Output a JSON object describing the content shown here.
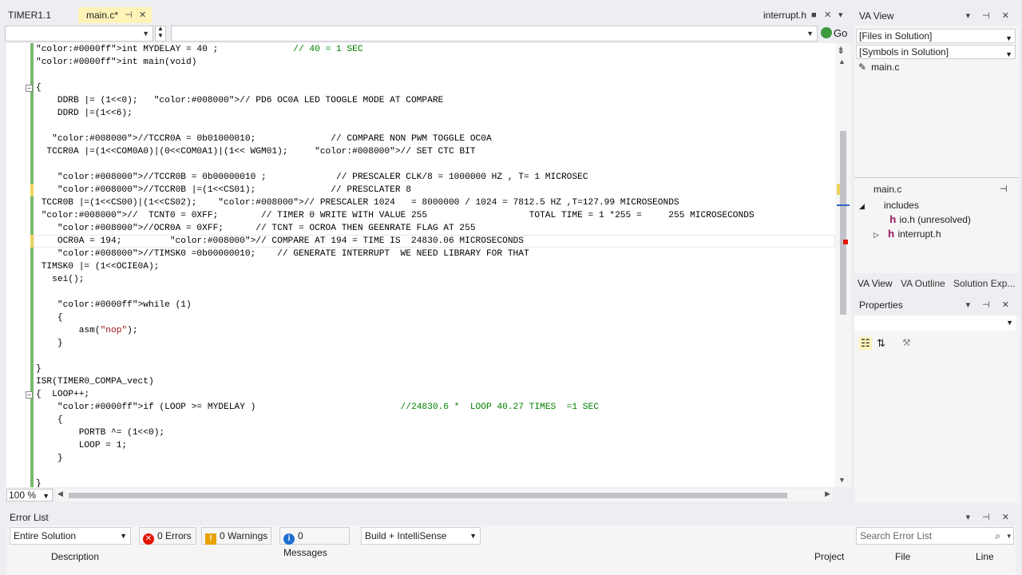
{
  "tabs": {
    "timer": "TIMER1.1",
    "main": "main.c*",
    "interrupt": "interrupt.h"
  },
  "navbar": {
    "go": "Go"
  },
  "zoom": "100 %",
  "code": [
    "int MYDELAY = 40 ;              // 40 = 1 SEC",
    "int main(void)",
    "",
    "{",
    "    DDRB |= (1<<0);   // PD6 OC0A LED TOOGLE MODE AT COMPARE",
    "    DDRD |=(1<<6);",
    "",
    "   //TCCR0A = 0b01000010;              // COMPARE NON PWM TOGGLE OC0A",
    "  TCCR0A |=(1<<COM0A0)|(0<<COM0A1)|(1<< WGM01);     // SET CTC BIT",
    "",
    "    //TCCR0B = 0b00000010 ;             // PRESCALER CLK/8 = 1000000 HZ , T= 1 MICROSEC",
    "    //TCCR0B |=(1<<CS01);              // PRESCLATER 8",
    " TCCR0B |=(1<<CS00)|(1<<CS02);    // PRESCALER 1024   = 8000000 / 1024 = 7812.5 HZ ,T=127.99 MICROSEONDS",
    " //  TCNT0 = 0XFF;        // TIMER 0 WRITE WITH VALUE 255                   TOTAL TIME = 1 *255 =     255 MICROSECONDS",
    "    //OCR0A = 0XFF;      // TCNT = OCROA THEN GEENRATE FLAG AT 255",
    "    OCR0A = 194;         // COMPARE AT 194 = TIME IS  24830.06 MICROSECONDS",
    "    //TIMSK0 =0b00000010;    // GENERATE INTERRUPT  WE NEED LIBRARY FOR THAT",
    " TIMSK0 |= (1<<OCIE0A);",
    "   sei();",
    "",
    "    while (1)",
    "    {",
    "        asm(\"nop\");",
    "    }",
    "",
    "}",
    "ISR(TIMER0_COMPA_vect)",
    "{  LOOP++;",
    "    if (LOOP >= MYDELAY )                           //24830.6 *  LOOP 40.27 TIMES  =1 SEC",
    "    {",
    "        PORTB ^= (1<<0);",
    "        LOOP = 1;",
    "    }",
    "",
    "}"
  ],
  "va_view": {
    "title": "VA View",
    "files_dd": "[Files in Solution]",
    "symbols_dd": "[Symbols in Solution]",
    "file": "main.c",
    "outline_title": "main.c",
    "includes": "includes",
    "inc1": "io.h (unresolved)",
    "inc2": "interrupt.h",
    "tabs": [
      "VA View",
      "VA Outline",
      "Solution Exp..."
    ]
  },
  "properties": {
    "title": "Properties"
  },
  "error_list": {
    "title": "Error List",
    "scope": "Entire Solution",
    "errors": "0 Errors",
    "warnings": "0 Warnings",
    "messages": "0 Messages",
    "build": "Build + IntelliSense",
    "search_placeholder": "Search Error List",
    "columns": {
      "description": "Description",
      "project": "Project",
      "file": "File",
      "line": "Line"
    }
  }
}
